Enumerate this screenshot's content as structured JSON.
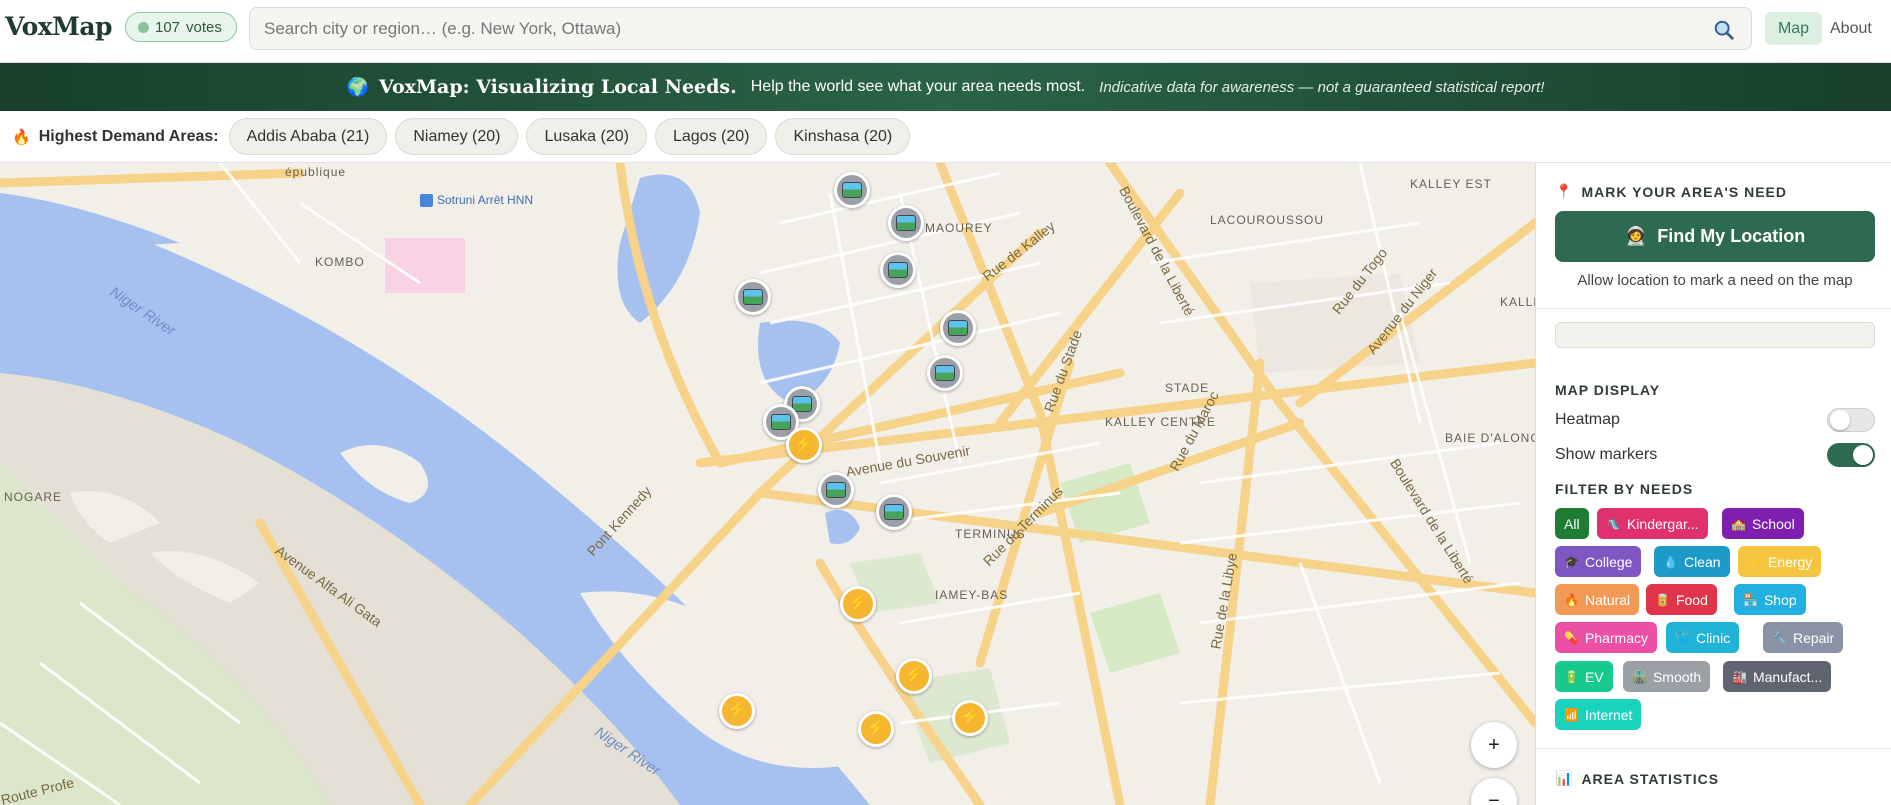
{
  "header": {
    "logo": "VoxMap",
    "votes_count": "107",
    "votes_label": "votes",
    "search_placeholder": "Search city or region… (e.g. New York, Ottawa)",
    "nav_map": "Map",
    "nav_about": "About"
  },
  "banner": {
    "icon": "🌍",
    "title": "VoxMap: Visualizing Local Needs.",
    "subtitle": "Help the world see what your area needs most.",
    "note": "Indicative data for awareness — not a guaranteed statistical report!"
  },
  "demand": {
    "icon": "🔥",
    "label": "Highest Demand Areas:",
    "areas": [
      "Addis Ababa (21)",
      "Niamey (20)",
      "Lusaka (20)",
      "Lagos (20)",
      "Kinshasa (20)"
    ]
  },
  "map": {
    "labels": {
      "republique": "épublique",
      "sotruni": "Sotruni Arrêt HNN",
      "maourey": "MAOUREY",
      "kalley_est": "KALLEY EST",
      "lacouroussou": "LACOUROUSSOU",
      "kombo": "KOMBO",
      "niger_river_1": "Niger River",
      "niger_river_2": "Niger River",
      "rue_kalley": "Rue de Kalley",
      "bd_liberte_1": "Boulevard de la Liberté",
      "bd_liberte_2": "Boulevard de la Liberté",
      "rue_togo": "Rue du Togo",
      "av_niger": "Avenue du Niger",
      "kalle": "KALLE",
      "stade": "STADE",
      "rue_stade": "Rue du Stade",
      "kalley_centre": "KALLEY CENTRE",
      "rue_maroc": "Rue du Maroc",
      "baie": "BAIE D'ALONG",
      "av_souvenir": "Avenue du Souvenir",
      "nogare": "NOGARE",
      "terminus": "TERMINUS",
      "rue_terminus": "Rue du Terminus",
      "pont_kennedy": "Pont Kennedy",
      "av_alfa": "Avenue Alfa Ali Gata",
      "niamey_bas": "IAMEY-BAS",
      "rue_libye": "Rue de la Libye",
      "route_prof": "Route Profe"
    },
    "zoom_in": "+",
    "zoom_out": "−"
  },
  "sidebar": {
    "mark_icon": "📍",
    "mark_title": "MARK YOUR AREA'S NEED",
    "find_icon": "🧑‍🚀",
    "find_label": "Find My Location",
    "hint": "Allow location to mark a need on the map",
    "display_title": "MAP DISPLAY",
    "heatmap_label": "Heatmap",
    "markers_label": "Show markers",
    "filter_title": "FILTER BY NEEDS",
    "stats_icon": "📊",
    "stats_title": "AREA STATISTICS"
  },
  "filters": [
    {
      "icon": "",
      "label": "All",
      "color": "#1e7d32"
    },
    {
      "icon": "🛝",
      "label": "Kindergar...",
      "color": "#e0306d"
    },
    {
      "icon": "🏫",
      "label": "School",
      "color": "#7e1fb0"
    },
    {
      "icon": "🎓",
      "label": "College",
      "color": "#7e57c2"
    },
    {
      "icon": "💧",
      "label": "Clean",
      "color": "#1e9ac8"
    },
    {
      "icon": "⚡",
      "label": "Energy",
      "color": "#f5c542"
    },
    {
      "icon": "🔥",
      "label": "Natural",
      "color": "#f29a55"
    },
    {
      "icon": "🥫",
      "label": "Food",
      "color": "#e0344a"
    },
    {
      "icon": "🏪",
      "label": "Shop",
      "color": "#22b0e0"
    },
    {
      "icon": "💊",
      "label": "Pharmacy",
      "color": "#ec4fa6"
    },
    {
      "icon": "🩺",
      "label": "Clinic",
      "color": "#1fb4d6"
    },
    {
      "icon": "🔧",
      "label": "Repair",
      "color": "#8a93a6"
    },
    {
      "icon": "🔋",
      "label": "EV",
      "color": "#17c98a"
    },
    {
      "icon": "🛣️",
      "label": "Smooth",
      "color": "#9aa0a6"
    },
    {
      "icon": "🏭",
      "label": "Manufact...",
      "color": "#5f6470"
    },
    {
      "icon": "📶",
      "label": "Internet",
      "color": "#18d4bf"
    }
  ]
}
